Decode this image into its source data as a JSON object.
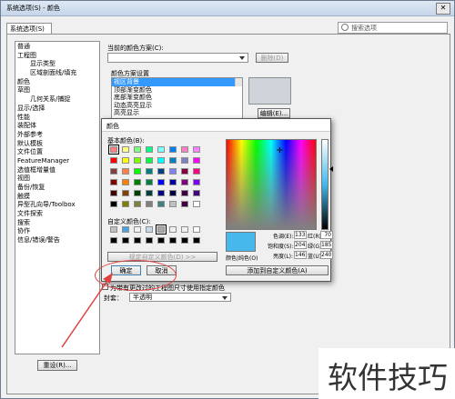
{
  "window": {
    "title": "系统选项(S) - 颜色",
    "close_label": "✕"
  },
  "tab": {
    "label": "系统选项(S)"
  },
  "search": {
    "placeholder": "搜索选项"
  },
  "tree": {
    "items": [
      {
        "label": "普通",
        "indent": 0
      },
      {
        "label": "工程图",
        "indent": 0
      },
      {
        "label": "显示类型",
        "indent": 1
      },
      {
        "label": "区域剖面线/填充",
        "indent": 1
      },
      {
        "label": "颜色",
        "indent": 0
      },
      {
        "label": "草图",
        "indent": 0
      },
      {
        "label": "几何关系/捕捉",
        "indent": 1
      },
      {
        "label": "显示/选择",
        "indent": 0
      },
      {
        "label": "性能",
        "indent": 0
      },
      {
        "label": "装配体",
        "indent": 0
      },
      {
        "label": "外部参考",
        "indent": 0
      },
      {
        "label": "默认模板",
        "indent": 0
      },
      {
        "label": "文件位置",
        "indent": 0
      },
      {
        "label": "FeatureManager",
        "indent": 0
      },
      {
        "label": "选值框增量值",
        "indent": 0
      },
      {
        "label": "视图",
        "indent": 0
      },
      {
        "label": "备份/恢复",
        "indent": 0
      },
      {
        "label": "触摸",
        "indent": 0
      },
      {
        "label": "异型孔向导/Toolbox",
        "indent": 0
      },
      {
        "label": "文件探索",
        "indent": 0
      },
      {
        "label": "搜索",
        "indent": 0
      },
      {
        "label": "协作",
        "indent": 0
      },
      {
        "label": "信息/错误/警告",
        "indent": 0
      }
    ],
    "reset_label": "重设(R)..."
  },
  "scheme": {
    "current_label": "当前的颜色方案(C):",
    "delete_label": "删除(D)",
    "settings_label": "颜色方案设置",
    "items": [
      "视区背景",
      "顶部渐变颜色",
      "底部渐变颜色",
      "动态高亮显示",
      "高亮显示"
    ],
    "selected_index": 0,
    "edit_label": "编辑(E)...",
    "checkbox_label": "为带有更改过的工程图尺寸使用指定颜色",
    "checkbox_prefix": "为",
    "envelope_label": "封套：",
    "envelope_value": "半透明"
  },
  "color_dialog": {
    "title": "颜色",
    "basic_label": "基本颜色(B):",
    "custom_label": "自定义颜色(C):",
    "define_label": "规定自定义颜色(D) >>",
    "ok_label": "确定",
    "cancel_label": "取消",
    "add_label": "添加到自定义颜色(A)",
    "color_solid_label": "颜色|纯色(O)",
    "hue_label": "色调(E):",
    "hue": "133",
    "sat_label": "饱和度(S):",
    "sat": "204",
    "lum_label": "亮度(L):",
    "lum": "146",
    "red_label": "红(R):",
    "red": "70",
    "green_label": "绿(G):",
    "green": "185",
    "blue_label": "蓝(U):",
    "blue": "240",
    "current_color": "#46b8ec",
    "basic_colors": [
      "#ff8080",
      "#ffff80",
      "#80ff80",
      "#00ff80",
      "#80ffff",
      "#0080ff",
      "#ff80c0",
      "#ff80ff",
      "#ff0000",
      "#ffff00",
      "#80ff00",
      "#00ff40",
      "#00ffff",
      "#0080c0",
      "#8080c0",
      "#ff00ff",
      "#804040",
      "#ff8040",
      "#00ff00",
      "#008080",
      "#004080",
      "#8080ff",
      "#800040",
      "#ff0080",
      "#800000",
      "#ff8000",
      "#008000",
      "#008040",
      "#0000ff",
      "#0000a0",
      "#800080",
      "#8000ff",
      "#400000",
      "#804000",
      "#004000",
      "#004040",
      "#000080",
      "#000040",
      "#400040",
      "#400080",
      "#000000",
      "#808000",
      "#808040",
      "#808080",
      "#408080",
      "#c0c0c0",
      "#400040",
      "#ffffff"
    ],
    "custom_colors": [
      "#c0c0c0",
      "#4aa3df",
      "#f0f0f0",
      "#c6d9ec",
      "#a8a8a8",
      "#f0f0f0",
      "#f0f0f0",
      "#ffffff",
      "#000000",
      "#000000",
      "#000000",
      "#000000",
      "#000000",
      "#000000",
      "#000000",
      "#000000"
    ]
  },
  "watermark": {
    "text": "软件技巧"
  }
}
